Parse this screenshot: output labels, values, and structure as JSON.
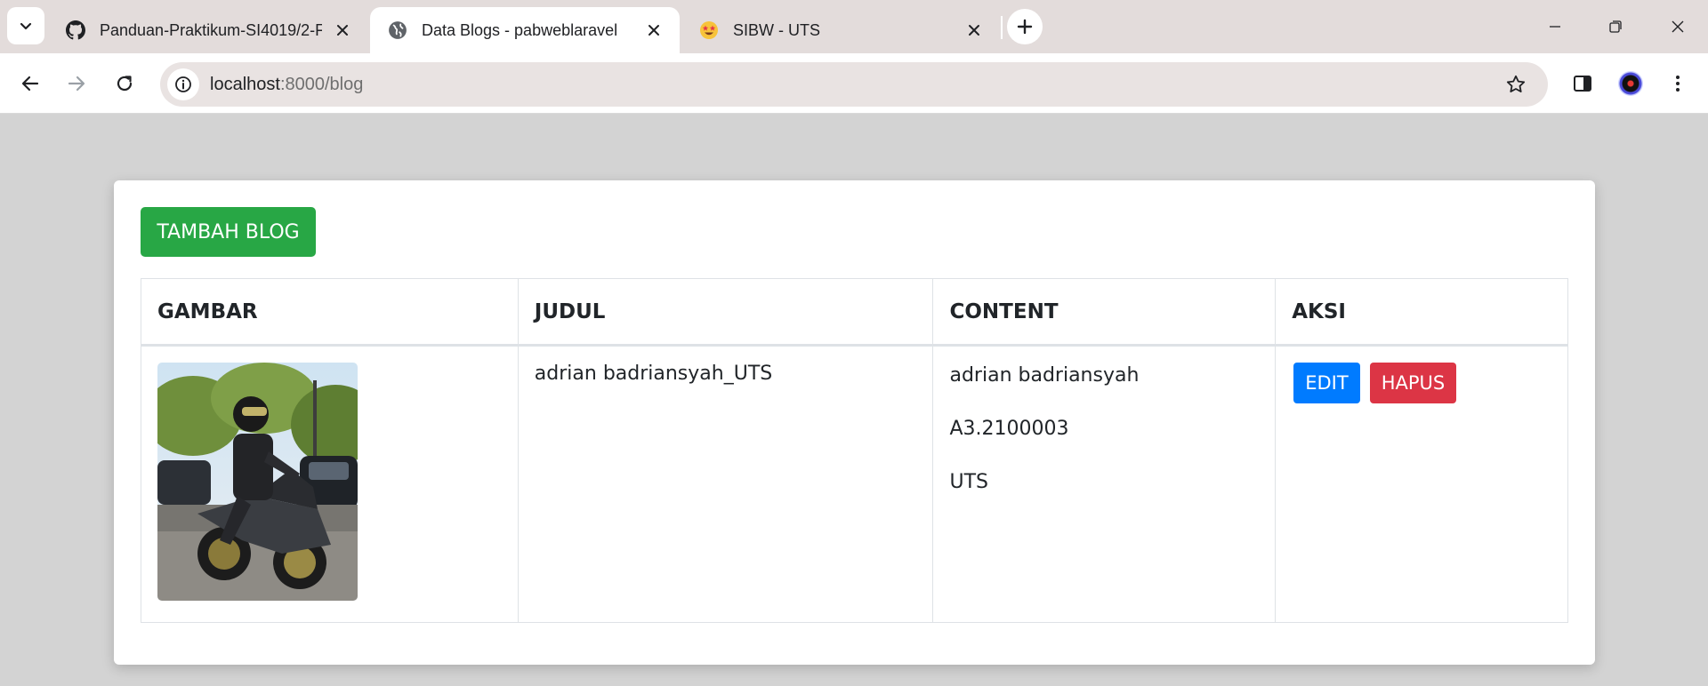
{
  "browser": {
    "tabs": [
      {
        "title": "Panduan-Praktikum-SI4019/2-F",
        "favicon": "github-icon",
        "active": false
      },
      {
        "title": "Data Blogs - pabweblaravel",
        "favicon": "globe-icon",
        "active": true
      },
      {
        "title": "SIBW - UTS",
        "favicon": "star-struck-emoji-icon",
        "active": false
      }
    ],
    "url": {
      "host": "localhost",
      "path": ":8000/blog"
    }
  },
  "page": {
    "add_button": "TAMBAH BLOG",
    "table": {
      "headers": {
        "gambar": "GAMBAR",
        "judul": "JUDUL",
        "content": "CONTENT",
        "aksi": "AKSI"
      },
      "rows": [
        {
          "image": "motorcycle-rider-photo",
          "judul": "adrian badriansyah_UTS",
          "content": [
            "adrian badriansyah",
            "A3.2100003",
            "UTS"
          ],
          "edit_label": "EDIT",
          "delete_label": "HAPUS"
        }
      ]
    }
  },
  "colors": {
    "add": "#28a745",
    "edit": "#007bff",
    "delete": "#dc3545",
    "page_bg": "#d3d3d3"
  }
}
